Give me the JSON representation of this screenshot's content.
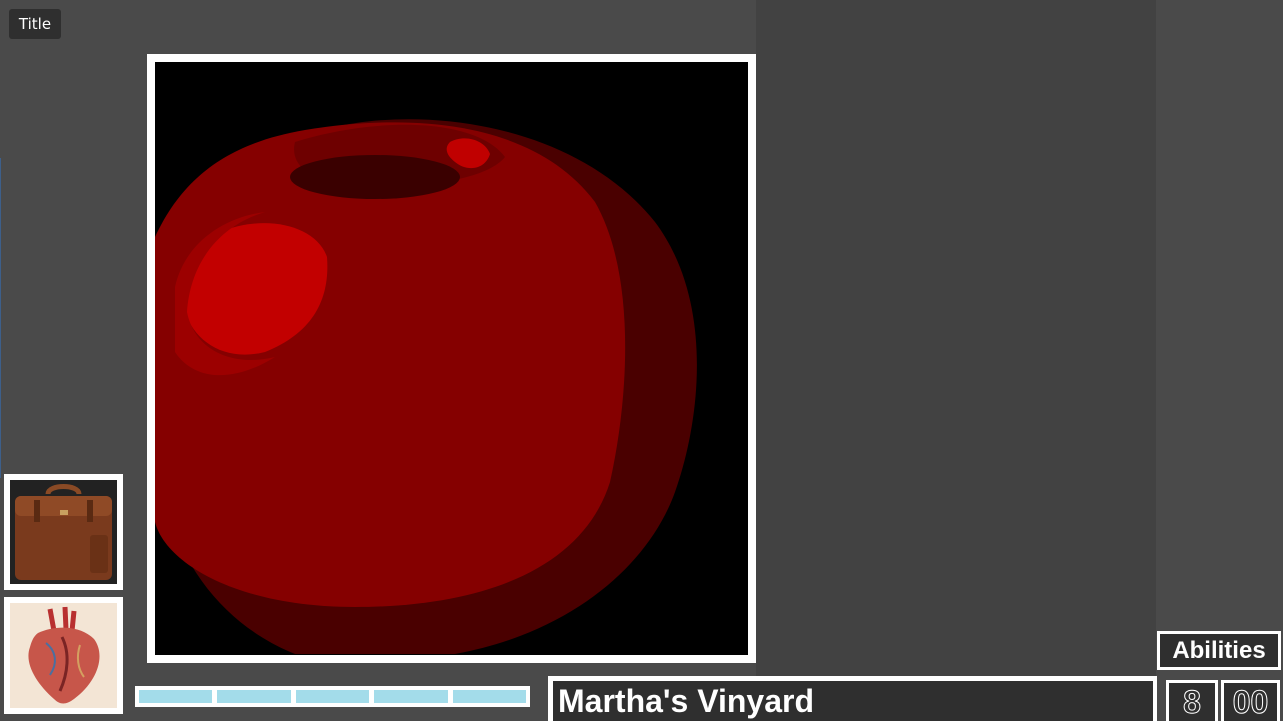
{
  "header": {
    "title_button": "Title"
  },
  "viewer": {
    "subject_icon": "red-apple-icon"
  },
  "inventory": {
    "slots": [
      {
        "icon": "briefcase-icon"
      },
      {
        "icon": "heart-icon"
      }
    ]
  },
  "status": {
    "health_segments": 5,
    "location_name": "Martha's Vinyard",
    "time_hours": "8",
    "time_minutes": "00"
  },
  "actions": {
    "abilities_label": "Abilities"
  },
  "colors": {
    "background": "#4a4a4a",
    "panel": "#424242",
    "health": "#a3dcea",
    "frame": "#ffffff"
  }
}
